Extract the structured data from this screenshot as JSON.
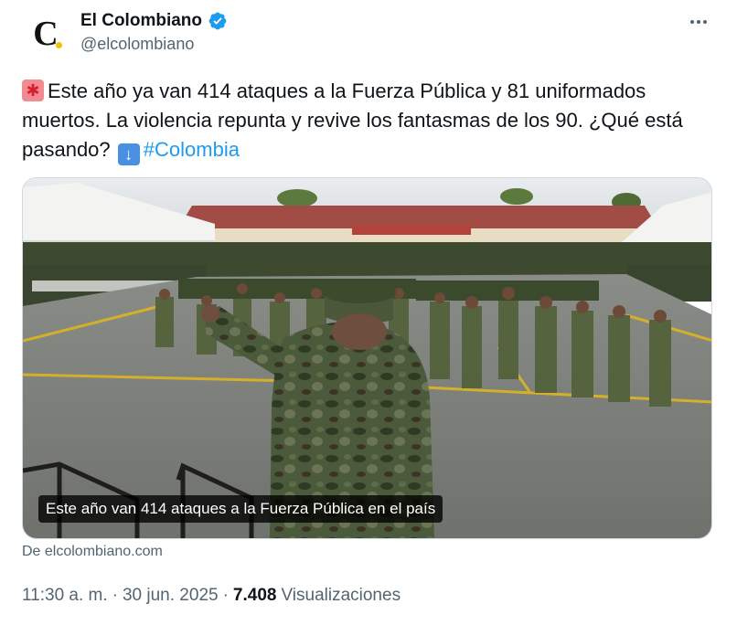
{
  "author": {
    "display_name": "El Colombiano",
    "handle": "@elcolombiano",
    "avatar_letter": "C",
    "verified": true
  },
  "tweet": {
    "emoji_start": "siren",
    "text_main": "Este año ya van 414 ataques a la Fuerza Pública y 81 uniformados muertos. La violencia repunta y revive los fantasmas de los 90. ¿Qué está pasando?",
    "emoji_mid": "down-arrow",
    "hashtag": "#Colombia"
  },
  "media": {
    "caption": "Este año van 414 ataques a la Fuerza Pública en el país"
  },
  "source_link": "De elcolombiano.com",
  "meta": {
    "time": "11:30 a. m.",
    "dot1": "·",
    "date": "30 jun. 2025",
    "dot2": "·",
    "views_count": "7.408",
    "views_label": "Visualizaciones"
  },
  "colors": {
    "link": "#1d9bf0",
    "secondary_text": "#536471",
    "primary_text": "#0f1419",
    "verified_badge": "#1d9bf0"
  }
}
